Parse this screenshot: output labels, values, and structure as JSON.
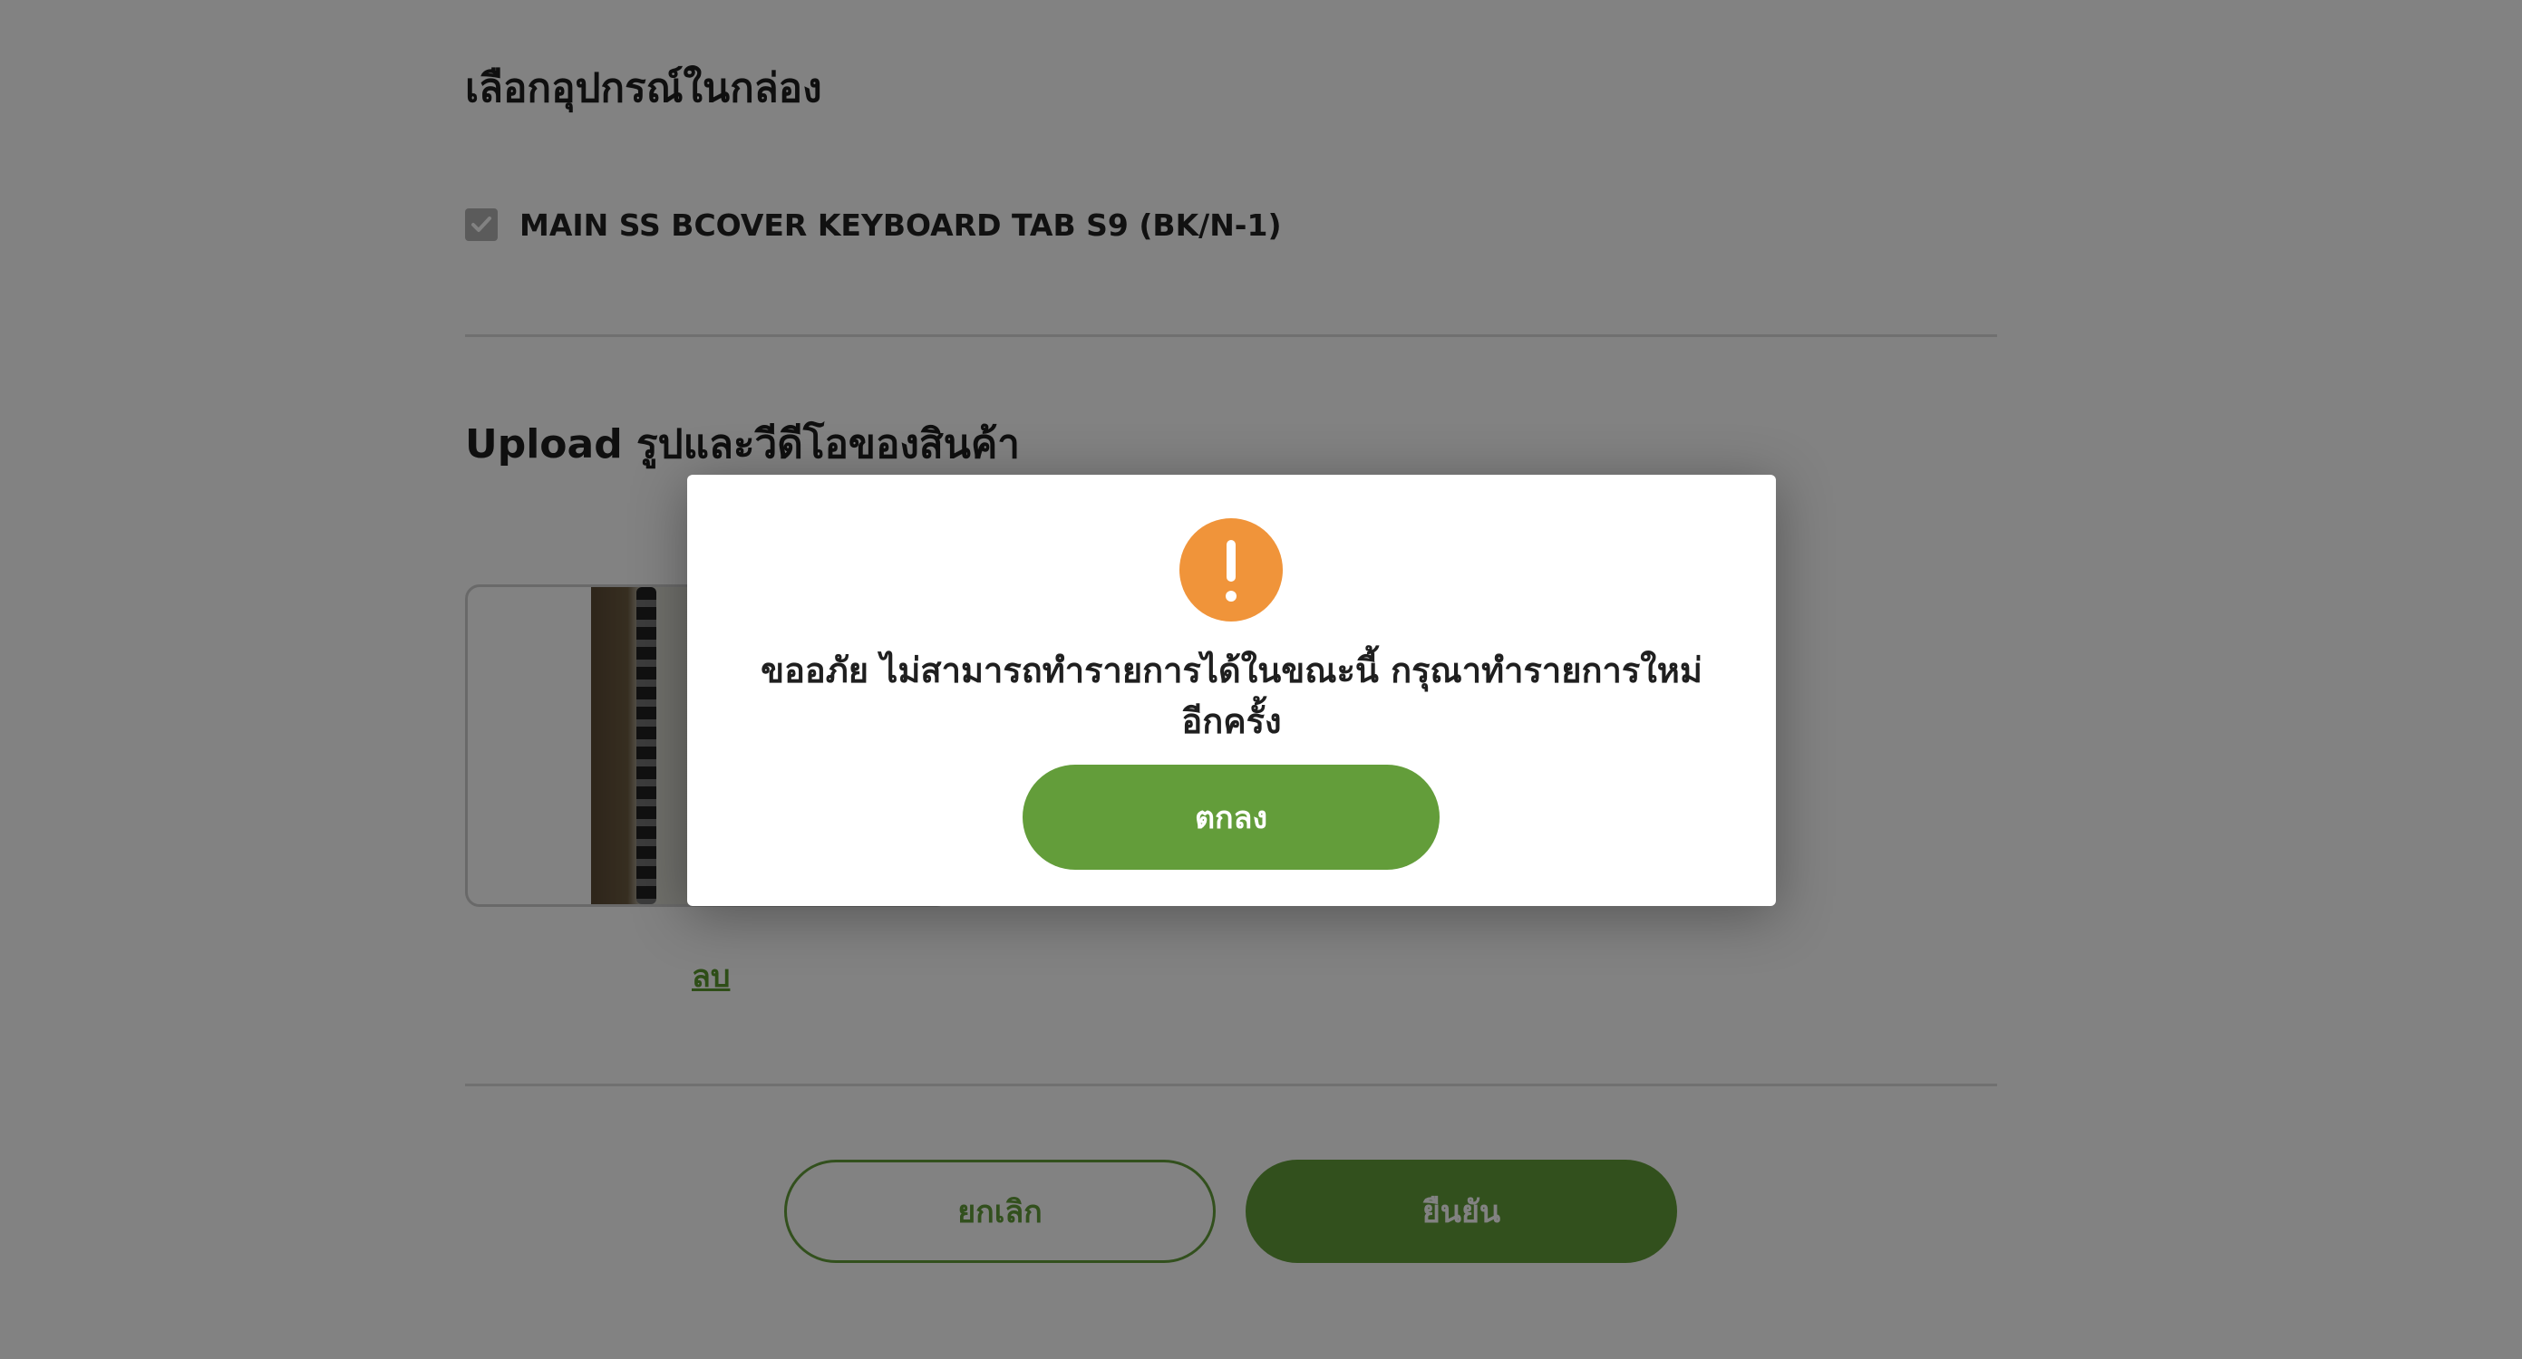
{
  "sections": {
    "accessories_title": "เลือกอุปกรณ์ในกล่อง",
    "upload_title": "Upload รูปและวีดีโอของสินค้า"
  },
  "accessories": [
    {
      "label": "MAIN SS BCOVER KEYBOARD TAB S9 (BK/N-1)",
      "checked": true
    }
  ],
  "upload": {
    "delete_label": "ลบ"
  },
  "actions": {
    "cancel_label": "ยกเลิก",
    "confirm_label": "ยืนยัน"
  },
  "modal": {
    "icon": "warning-icon",
    "message": "ขออภัย ไม่สามารถทำรายการได้ในขณะนี้ กรุณาทำรายการใหม่อีกครั้ง",
    "ok_label": "ตกลง"
  },
  "colors": {
    "brand_green": "#639d3a",
    "warning_orange": "#f0943a",
    "overlay": "rgba(0,0,0,0.49)"
  }
}
